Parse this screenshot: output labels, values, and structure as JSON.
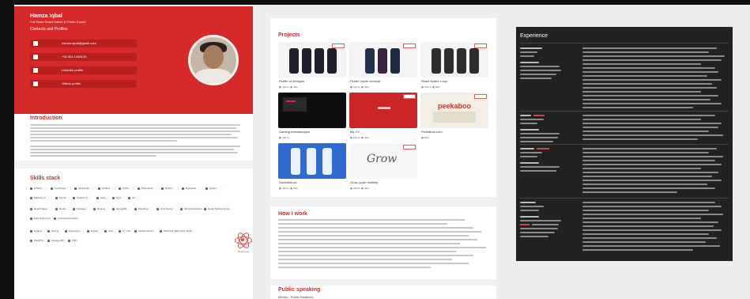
{
  "profile": {
    "name": "Hamza Iqbal",
    "role": "Full Stack React Native & Flutter Expert",
    "contacts_title": "Contacts and Profiles",
    "contacts": [
      {
        "label": "hamza.iqbal@gmail.com",
        "icon": "mail-icon"
      },
      {
        "label": "+92 301 1246124",
        "icon": "phone-icon"
      },
      {
        "label": "LinkedIn profile",
        "icon": "linkedin-icon"
      },
      {
        "label": "Github profile",
        "icon": "github-icon"
      }
    ]
  },
  "introduction": {
    "title": "Introduction"
  },
  "skills": {
    "title": "Skills stack",
    "rows": [
      [
        "HTML5",
        "TypeScript",
        "JavaScript",
        "HTML5",
        "CSS3",
        "Photoshop",
        "Redux",
        "Bootstrap",
        "jQuery"
      ],
      [
        "Material UI",
        "Figma",
        "Chakra UI",
        "Sass",
        "Npm",
        "Git"
      ],
      [
        "React Native",
        "Redux",
        "Firebase",
        "Node.js",
        "MongoDB",
        "Bootstrap",
        "Unit Testing",
        "Microinteractions",
        "React Testing Library"
      ],
      [
        "Flow Python UI",
        "Frontend Animation"
      ],
      [
        "Node.js",
        "Next.js",
        "Express.js",
        "Docker",
        "Jest",
        "CI / CD",
        "GitHub Actions",
        "AWS (S3, EB2, EC2, ECS)"
      ],
      [
        "WebRTC",
        "Storage DB",
        "TBD"
      ]
    ],
    "react_label": "React Live"
  },
  "projects": {
    "title": "Projects",
    "cards": [
      {
        "title": "Flutter UI Designs",
        "kind": "phones"
      },
      {
        "title": "Flutter movie concept",
        "kind": "phones"
      },
      {
        "title": "React Native Loop",
        "kind": "phones"
      },
      {
        "title": "Gaming Animastopper",
        "kind": "dark"
      },
      {
        "title": "My CV",
        "kind": "red"
      },
      {
        "title": "Peekaboo.com",
        "kind": "peek"
      },
      {
        "title": "Saveslink.pk",
        "kind": "blue"
      },
      {
        "title": "Grow youth mobility",
        "kind": "grow"
      }
    ],
    "peek_logo": "peekaboo",
    "grow_logo": "Grow"
  },
  "how_i_work": {
    "title": "How I work"
  },
  "public_speaking": {
    "title": "Public speaking",
    "subtitle": "Mentor / Public Relations"
  },
  "experience": {
    "title": "Experience"
  },
  "colors": {
    "accent": "#d62a2a",
    "dark": "#222222"
  }
}
